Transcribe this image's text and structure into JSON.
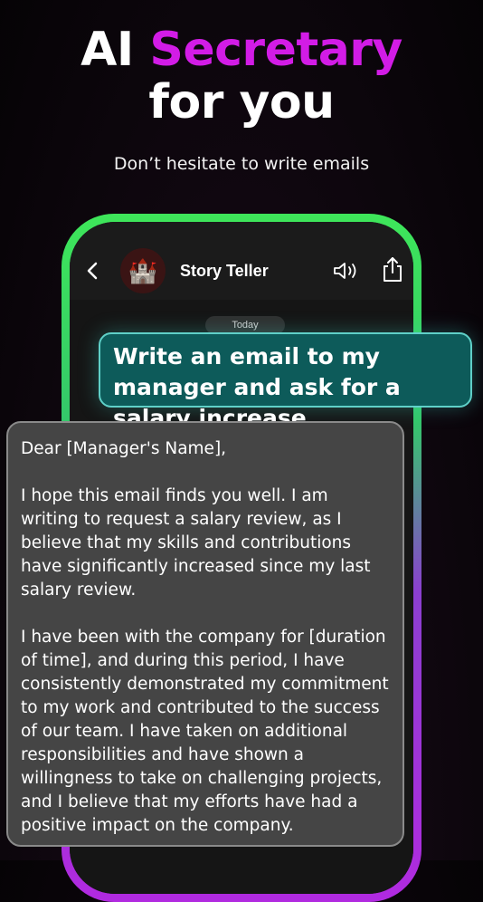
{
  "hero": {
    "title_prefix": "AI",
    "title_accent": "Secretary",
    "title_line2": "for you",
    "subtitle": "Don’t hesitate to write emails"
  },
  "chat": {
    "header": {
      "title": "Story Teller",
      "avatar_icon": "castle-icon",
      "back_icon": "chevron-left-icon",
      "speaker_icon": "speaker-icon",
      "share_icon": "share-icon"
    },
    "date_label": "Today",
    "user_message": "Write an email to my manager and ask for a salary increase",
    "reply": {
      "paragraphs": [
        "Dear [Manager's Name],",
        "I hope this email finds you well. I am writing to request a salary review, as I believe that my skills and contributions have significantly increased since my last salary review.",
        "I have been with the company for [duration of time], and during this period, I have consistently demonstrated my commitment to my work and contributed to the success of our team. I have taken on additional responsibilities and have shown a willingness to take on challenging projects, and I believe that my efforts have had a positive impact on the company."
      ]
    }
  },
  "colors": {
    "accent": "#d21ce6",
    "user_bubble": "#0d5b5a",
    "reply_bubble": "#454545",
    "frame_top": "#3ee65a",
    "frame_bottom": "#b12ae0"
  }
}
